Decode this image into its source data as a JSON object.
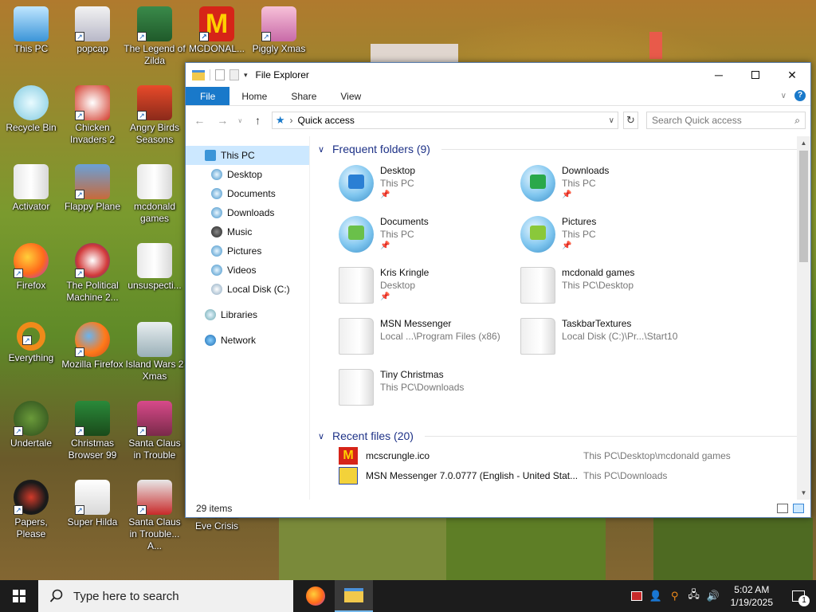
{
  "desktop": {
    "icons": [
      {
        "label": "This PC"
      },
      {
        "label": "popcap"
      },
      {
        "label": "The Legend of Zilda"
      },
      {
        "label": "MCDONAL..."
      },
      {
        "label": "Piggly Xmas"
      },
      {
        "label": "Recycle Bin"
      },
      {
        "label": "Chicken Invaders 2"
      },
      {
        "label": "Angry Birds Seasons"
      },
      {
        "label": "Activator"
      },
      {
        "label": "Flappy Plane"
      },
      {
        "label": "mcdonald games"
      },
      {
        "label": "Firefox"
      },
      {
        "label": "The Political Machine 2..."
      },
      {
        "label": "unsuspecti..."
      },
      {
        "label": "Everything"
      },
      {
        "label": "Mozilla Firefox"
      },
      {
        "label": "Island Wars 2 Xmas"
      },
      {
        "label": "Undertale"
      },
      {
        "label": "Christmas Browser 99"
      },
      {
        "label": "Santa Claus in Trouble"
      },
      {
        "label": "Papers, Please"
      },
      {
        "label": "Super Hilda"
      },
      {
        "label": "Santa Claus in Trouble... A..."
      },
      {
        "label": "Christmas Eve Crisis"
      }
    ]
  },
  "explorer": {
    "title": "File Explorer",
    "ribbon_tabs": [
      "File",
      "Home",
      "Share",
      "View"
    ],
    "address": {
      "location": "Quick access"
    },
    "search": {
      "placeholder": "Search Quick access"
    },
    "nav": [
      {
        "label": "This PC"
      },
      {
        "label": "Desktop"
      },
      {
        "label": "Documents"
      },
      {
        "label": "Downloads"
      },
      {
        "label": "Music"
      },
      {
        "label": "Pictures"
      },
      {
        "label": "Videos"
      },
      {
        "label": "Local Disk (C:)"
      },
      {
        "label": "Libraries"
      },
      {
        "label": "Network"
      }
    ],
    "frequent_header": "Frequent folders (9)",
    "folders": [
      {
        "name": "Desktop",
        "location": "This PC"
      },
      {
        "name": "Downloads",
        "location": "This PC"
      },
      {
        "name": "Documents",
        "location": "This PC"
      },
      {
        "name": "Pictures",
        "location": "This PC"
      },
      {
        "name": "Kris Kringle",
        "location": "Desktop"
      },
      {
        "name": "mcdonald games",
        "location": "This PC\\Desktop"
      },
      {
        "name": "MSN Messenger",
        "location": "Local ...\\Program Files (x86)"
      },
      {
        "name": "TaskbarTextures",
        "location": "Local Disk (C:)\\Pr...\\Start10"
      },
      {
        "name": "Tiny Christmas",
        "location": "This PC\\Downloads"
      }
    ],
    "recent_header": "Recent files (20)",
    "recent": [
      {
        "name": "mcscrungle.ico",
        "path": "This PC\\Desktop\\mcdonald games"
      },
      {
        "name": "MSN Messenger 7.0.0777 (English - United Stat...",
        "path": "This PC\\Downloads"
      }
    ],
    "status": {
      "items": "29 items"
    }
  },
  "taskbar": {
    "search_placeholder": "Type here to search",
    "time": "5:02 AM",
    "date": "1/19/2025",
    "notification_count": "1"
  },
  "colors": {
    "accent": "#1979ca",
    "selection": "#cce8ff",
    "group_header": "#1e3287"
  }
}
